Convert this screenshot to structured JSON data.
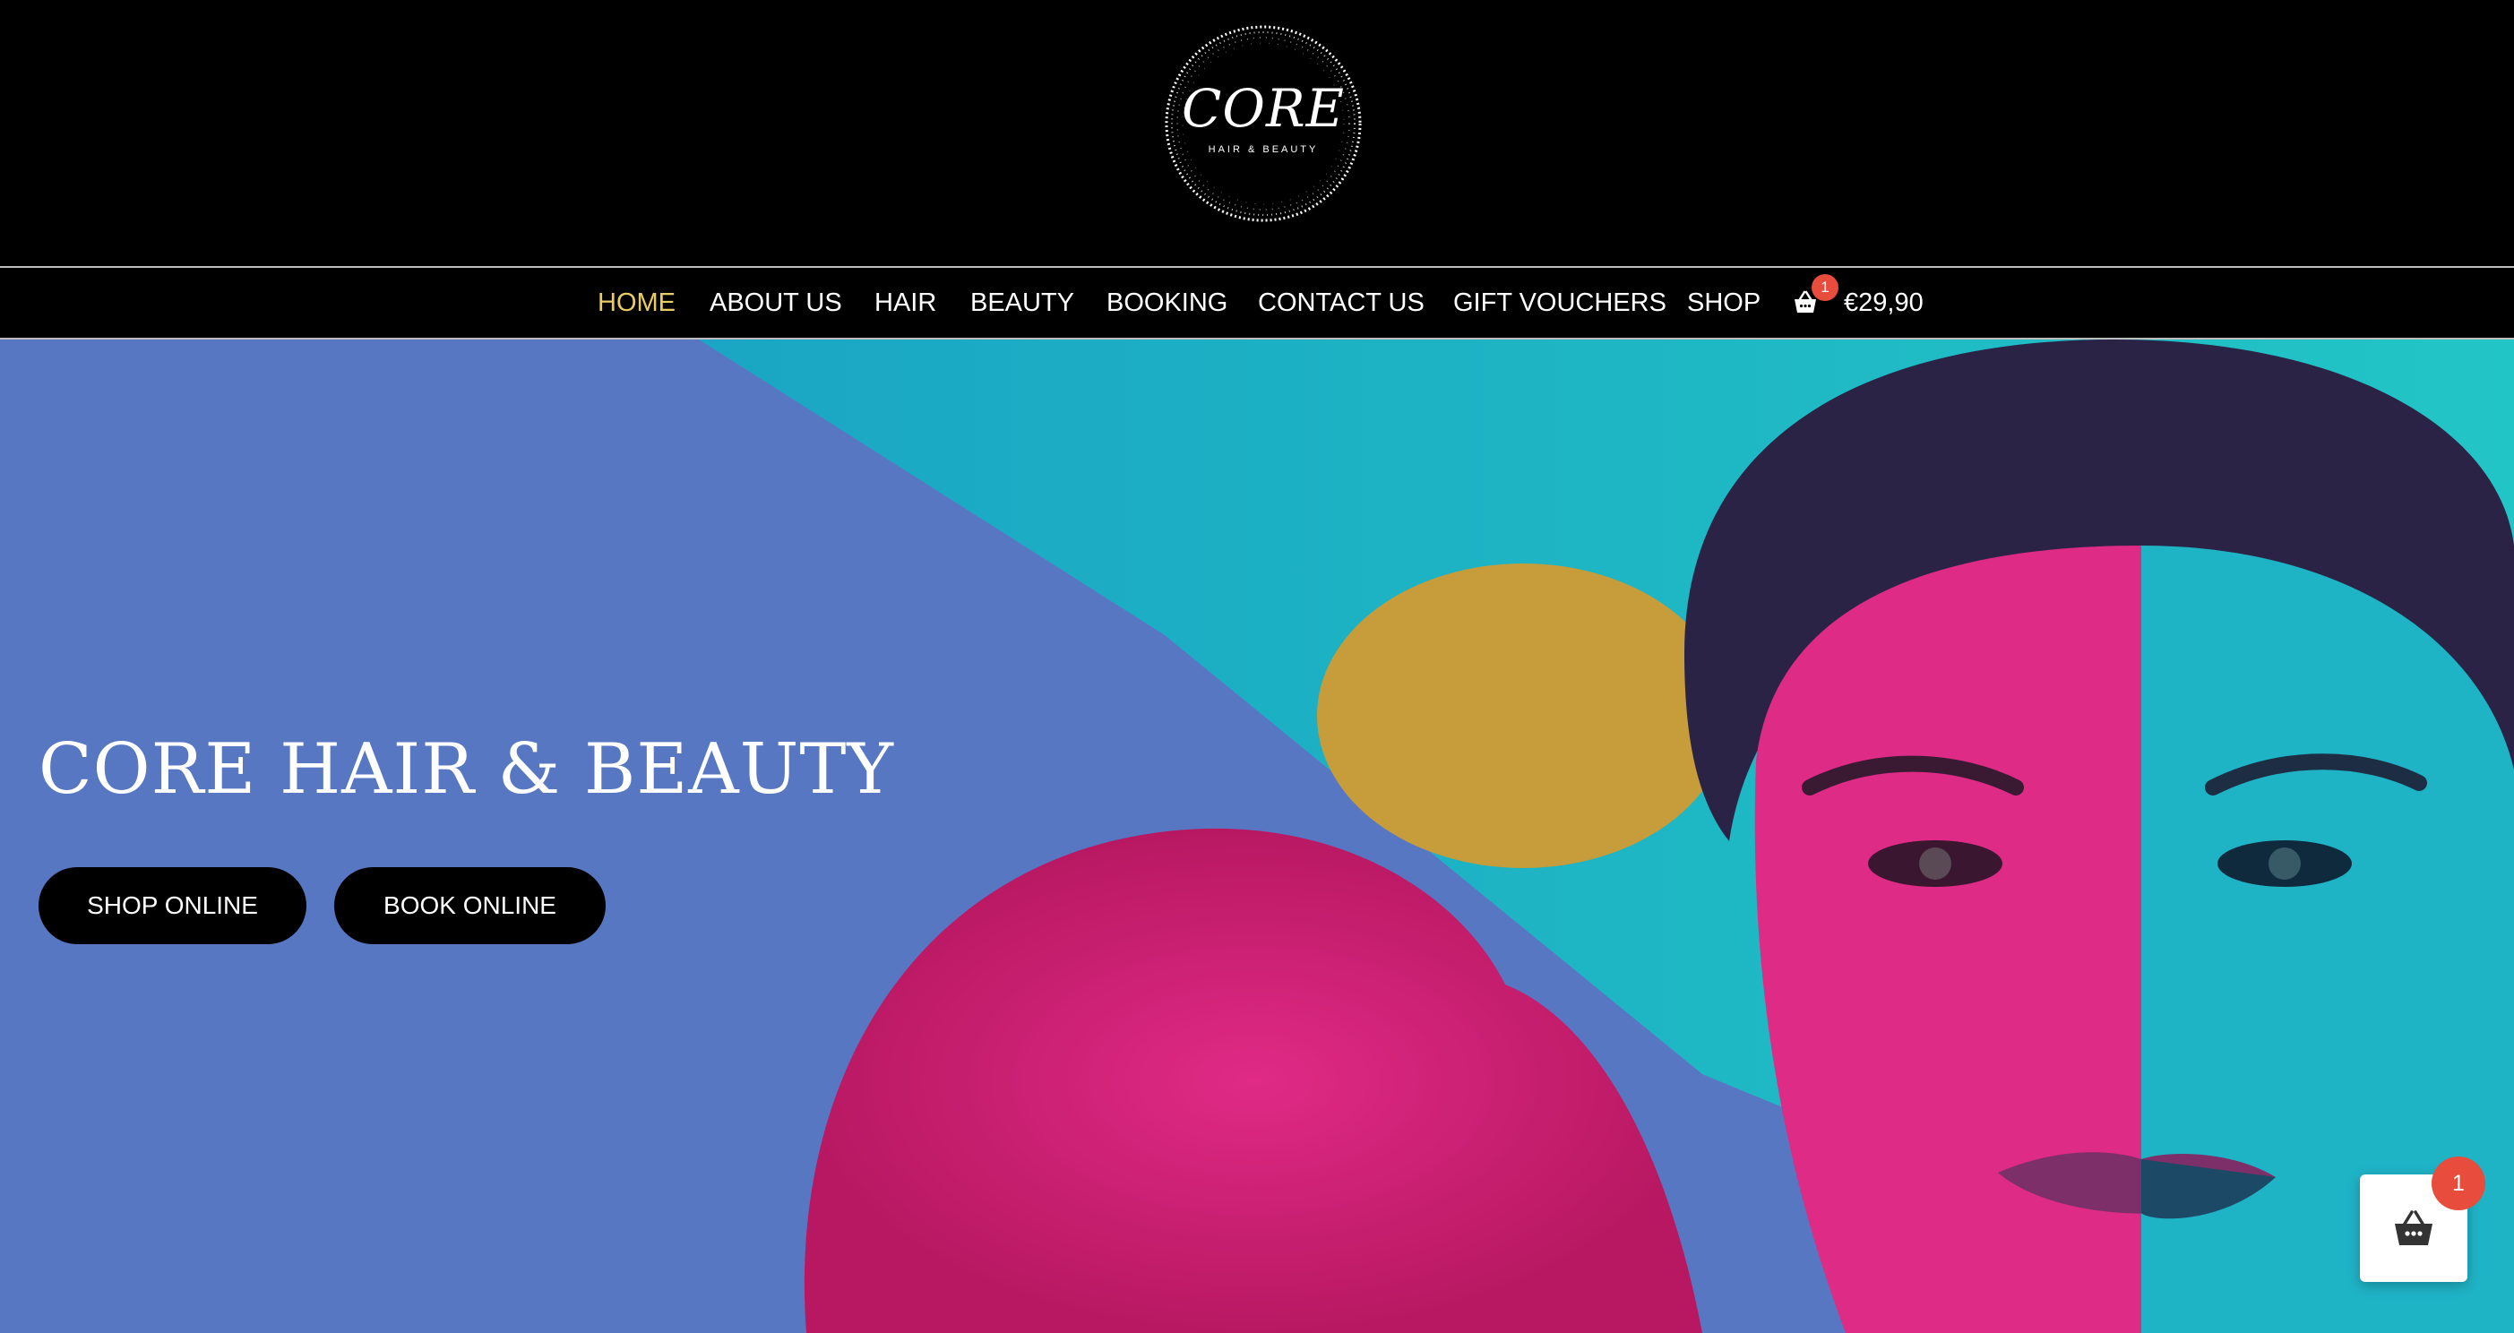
{
  "brand": {
    "logo_main": "CORE",
    "logo_sub": "HAIR & BEAUTY"
  },
  "nav": {
    "items": [
      {
        "label": "HOME",
        "active": true
      },
      {
        "label": "ABOUT US"
      },
      {
        "label": "HAIR"
      },
      {
        "label": "BEAUTY"
      },
      {
        "label": "BOOKING"
      },
      {
        "label": "CONTACT US"
      },
      {
        "label": "GIFT VOUCHERS"
      },
      {
        "label": "SHOP"
      }
    ],
    "cart_icon": "basket-icon",
    "cart_count": "1",
    "cart_total": "€29,90",
    "active_color": "#e9cd64"
  },
  "hero": {
    "title": "CORE HAIR & BEAUTY",
    "shop_button": "SHOP ONLINE",
    "book_button": "BOOK ONLINE",
    "background_color": "#5877c2"
  },
  "floating_cart": {
    "icon": "basket-icon",
    "count": "1",
    "badge_color": "#e74c3c"
  }
}
